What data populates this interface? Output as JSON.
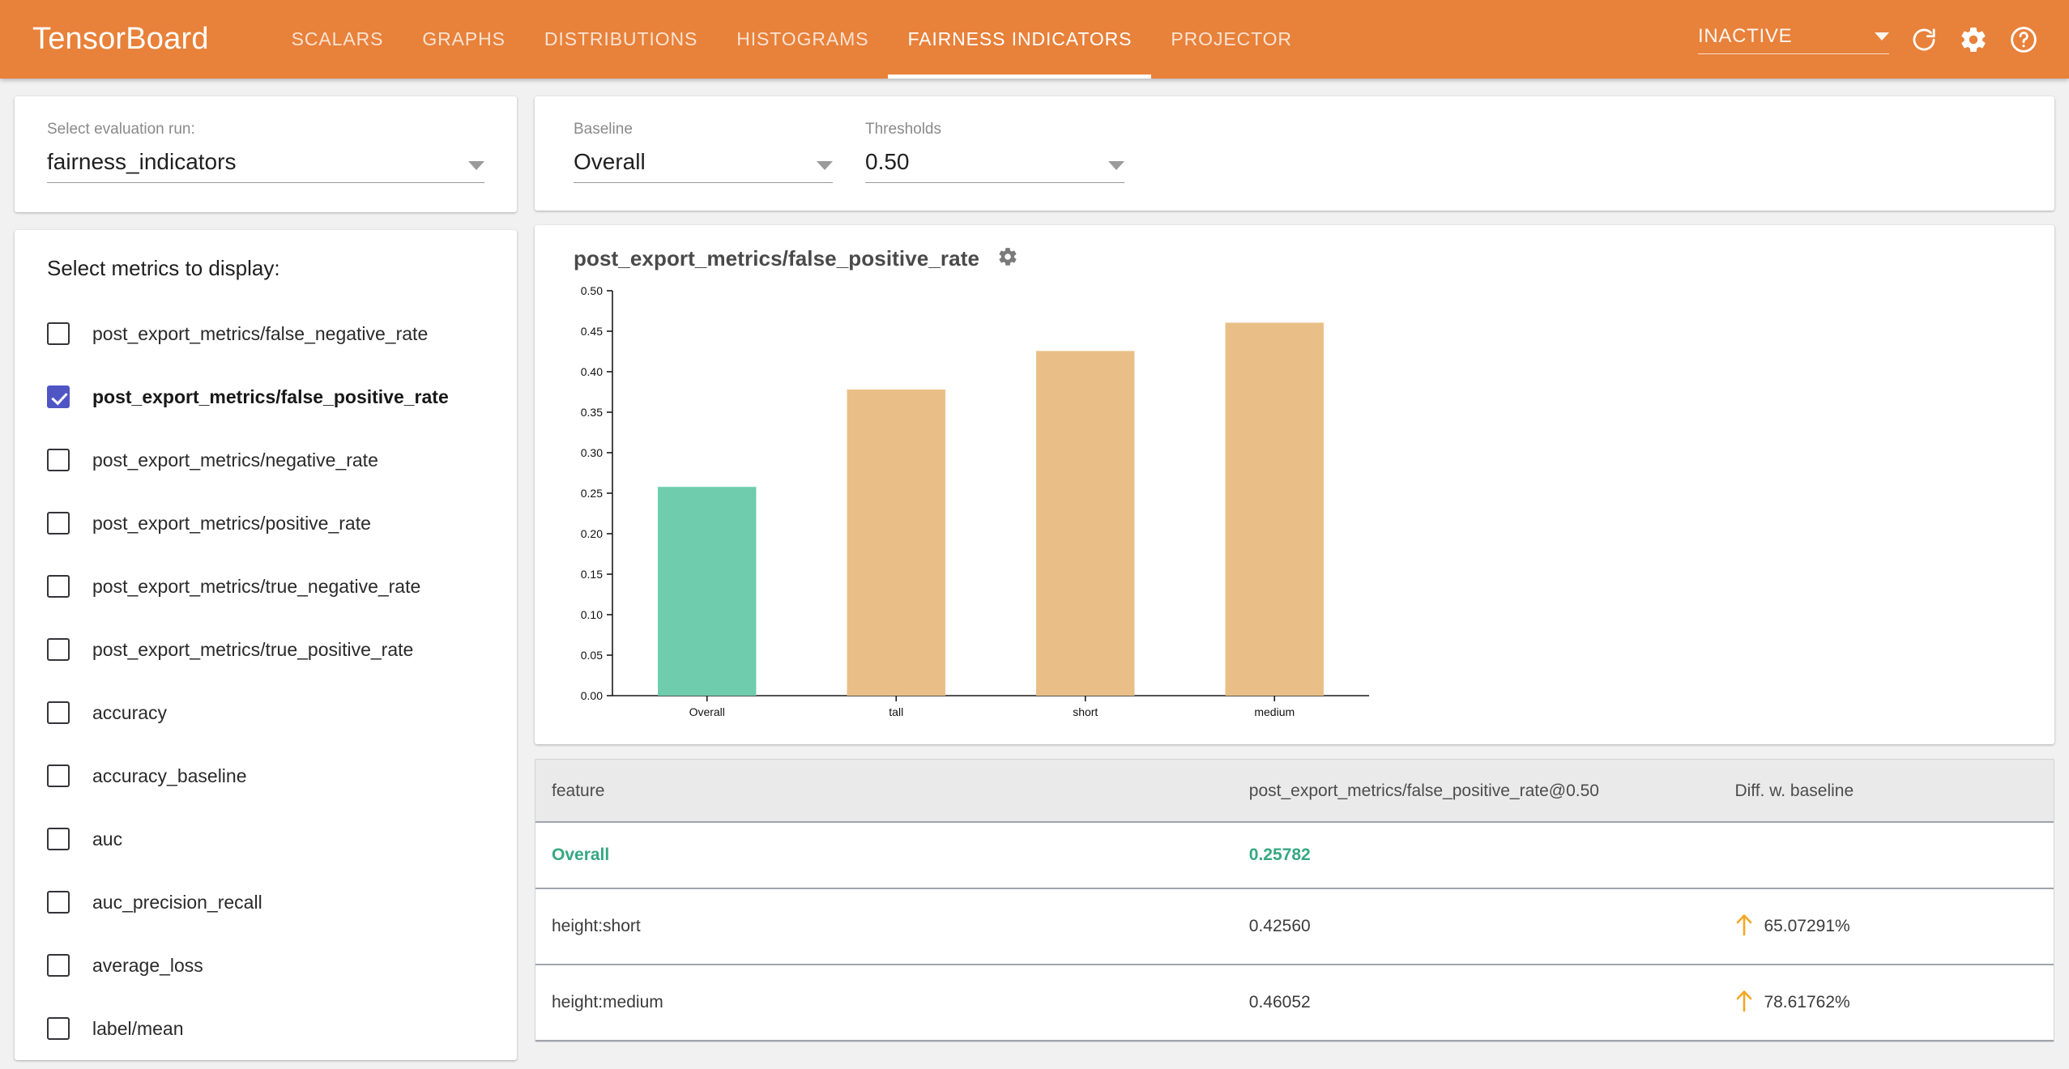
{
  "header": {
    "brand": "TensorBoard",
    "tabs": [
      {
        "label": "SCALARS",
        "active": false
      },
      {
        "label": "GRAPHS",
        "active": false
      },
      {
        "label": "DISTRIBUTIONS",
        "active": false
      },
      {
        "label": "HISTOGRAMS",
        "active": false
      },
      {
        "label": "FAIRNESS INDICATORS",
        "active": true
      },
      {
        "label": "PROJECTOR",
        "active": false
      }
    ],
    "run_state": "INACTIVE",
    "icons": [
      "refresh-icon",
      "settings-gear-icon",
      "help-icon"
    ],
    "accent_color": "#e8813a"
  },
  "sidebar": {
    "run_selector": {
      "label": "Select evaluation run:",
      "value": "fairness_indicators"
    },
    "metrics_title": "Select metrics to display:",
    "metrics": [
      {
        "label": "post_export_metrics/false_negative_rate",
        "checked": false
      },
      {
        "label": "post_export_metrics/false_positive_rate",
        "checked": true
      },
      {
        "label": "post_export_metrics/negative_rate",
        "checked": false
      },
      {
        "label": "post_export_metrics/positive_rate",
        "checked": false
      },
      {
        "label": "post_export_metrics/true_negative_rate",
        "checked": false
      },
      {
        "label": "post_export_metrics/true_positive_rate",
        "checked": false
      },
      {
        "label": "accuracy",
        "checked": false
      },
      {
        "label": "accuracy_baseline",
        "checked": false
      },
      {
        "label": "auc",
        "checked": false
      },
      {
        "label": "auc_precision_recall",
        "checked": false
      },
      {
        "label": "average_loss",
        "checked": false
      },
      {
        "label": "label/mean",
        "checked": false
      }
    ],
    "checked_color": "#4f56c4"
  },
  "controls": {
    "baseline": {
      "label": "Baseline",
      "value": "Overall"
    },
    "thresholds": {
      "label": "Thresholds",
      "value": "0.50"
    }
  },
  "chart_panel": {
    "title": "post_export_metrics/false_positive_rate",
    "settings_icon": "gear-icon"
  },
  "chart_data": {
    "type": "bar",
    "title": "post_export_metrics/false_positive_rate",
    "xlabel": "",
    "ylabel": "",
    "categories": [
      "Overall",
      "tall",
      "short",
      "medium"
    ],
    "values": [
      0.25782,
      0.378,
      0.4256,
      0.46052
    ],
    "bar_colors": [
      "#6fcdae",
      "#e9bf87",
      "#e9bf87",
      "#e9bf87"
    ],
    "ylim": [
      0.0,
      0.5
    ],
    "yticks": [
      "0.00",
      "0.05",
      "0.10",
      "0.15",
      "0.20",
      "0.25",
      "0.30",
      "0.35",
      "0.40",
      "0.45",
      "0.50"
    ],
    "grid": false,
    "legend": "none",
    "baseline_category": "Overall"
  },
  "table": {
    "columns": [
      "feature",
      "post_export_metrics/false_positive_rate@0.50",
      "Diff. w. baseline"
    ],
    "rows": [
      {
        "feature": "Overall",
        "value": "0.25782",
        "diff": "",
        "baseline": true,
        "direction": ""
      },
      {
        "feature": "height:short",
        "value": "0.42560",
        "diff": "65.07291%",
        "baseline": false,
        "direction": "up"
      },
      {
        "feature": "height:medium",
        "value": "0.46052",
        "diff": "78.61762%",
        "baseline": false,
        "direction": "up"
      }
    ],
    "arrow_up_color": "#f5a623",
    "baseline_color": "#36a880"
  }
}
